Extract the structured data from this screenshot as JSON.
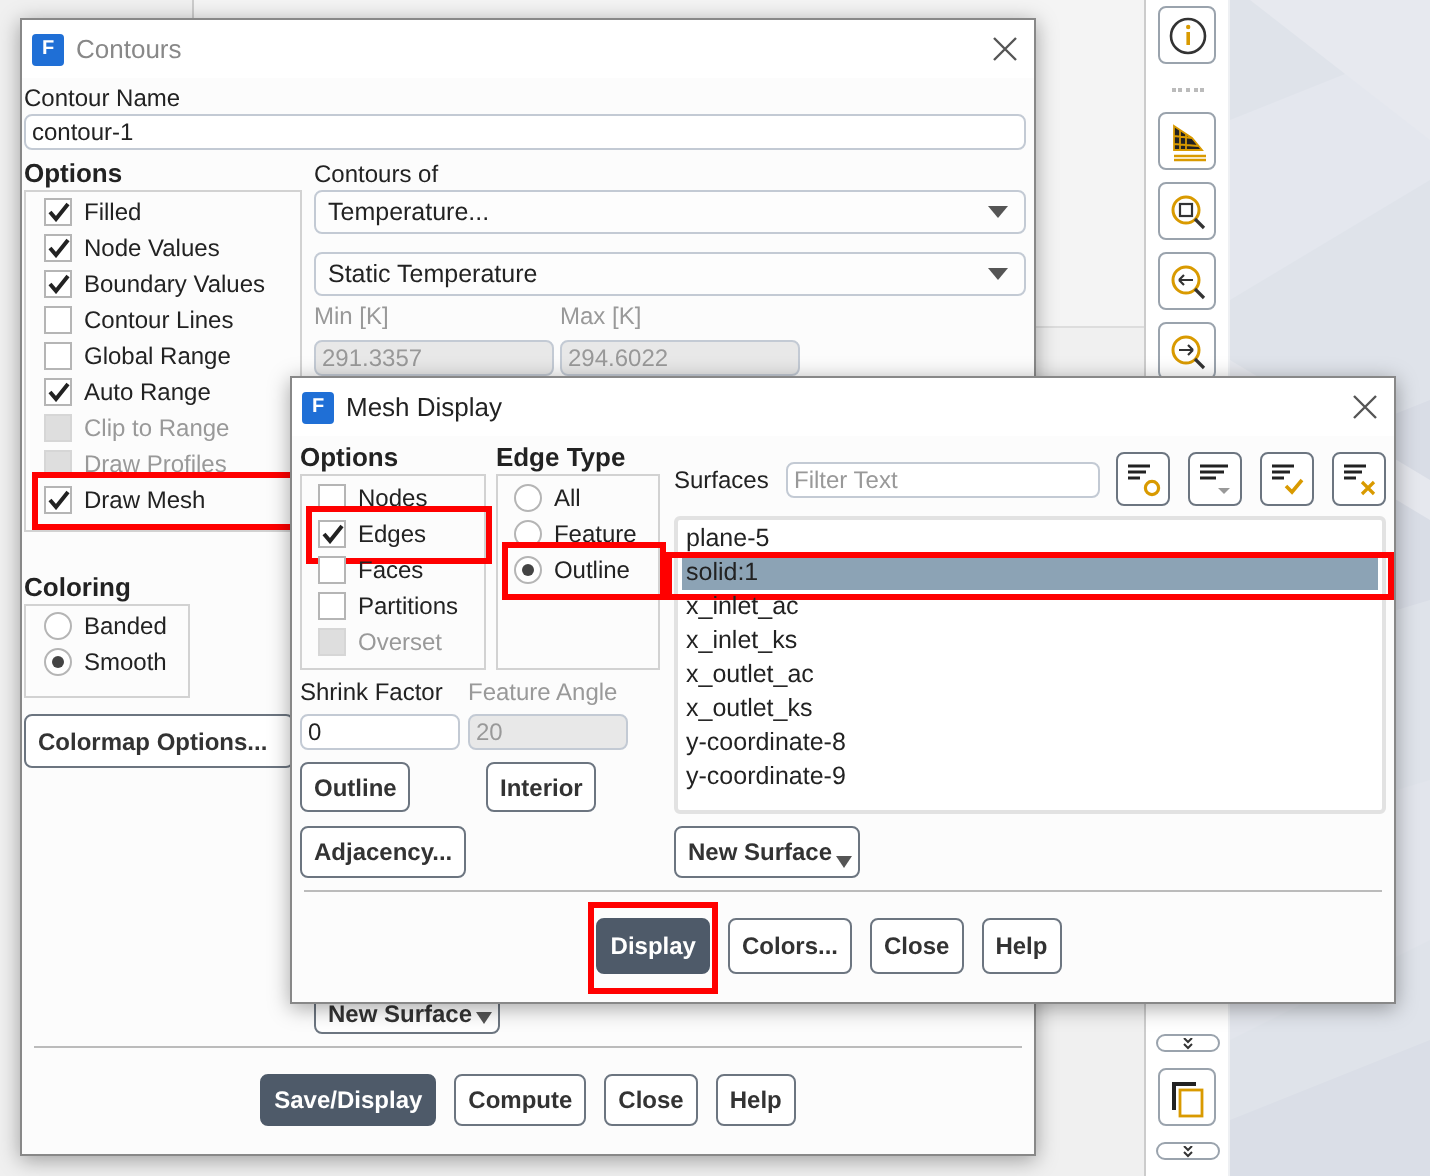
{
  "toolbar": {
    "top_buttons": [
      {
        "kind": "info"
      },
      {
        "kind": "mesh"
      },
      {
        "kind": "zoom_box"
      },
      {
        "kind": "zoom_left"
      },
      {
        "kind": "zoom_right"
      }
    ],
    "bottom_buttons": [
      {
        "kind": "expander"
      },
      {
        "kind": "pages"
      },
      {
        "kind": "expander"
      }
    ]
  },
  "contours_dialog": {
    "app_icon": "F",
    "title": "Contours",
    "contour_name_label": "Contour Name",
    "contour_name": "contour-1",
    "options_label": "Options",
    "options": [
      {
        "label": "Filled",
        "checked": true,
        "disabled": false,
        "highlighted": false
      },
      {
        "label": "Node Values",
        "checked": true,
        "disabled": false,
        "highlighted": false
      },
      {
        "label": "Boundary Values",
        "checked": true,
        "disabled": false,
        "highlighted": false
      },
      {
        "label": "Contour Lines",
        "checked": false,
        "disabled": false,
        "highlighted": false
      },
      {
        "label": "Global Range",
        "checked": false,
        "disabled": false,
        "highlighted": false
      },
      {
        "label": "Auto Range",
        "checked": true,
        "disabled": false,
        "highlighted": false
      },
      {
        "label": "Clip to Range",
        "checked": false,
        "disabled": true,
        "highlighted": false
      },
      {
        "label": "Draw Profiles",
        "checked": false,
        "disabled": true,
        "highlighted": false
      },
      {
        "label": "Draw Mesh",
        "checked": true,
        "disabled": false,
        "highlighted": true
      }
    ],
    "contours_of_label": "Contours of",
    "contours_of": "Temperature...",
    "field_variable": "Static Temperature",
    "min_label": "Min [K]",
    "min_value": "291.3357",
    "max_label": "Max [K]",
    "max_value": "294.6022",
    "coloring_label": "Coloring",
    "coloring": [
      {
        "label": "Banded",
        "selected": false
      },
      {
        "label": "Smooth",
        "selected": true
      }
    ],
    "colormap_button": "Colormap Options...",
    "new_surface_button": "New Surface",
    "buttons": [
      {
        "label": "Save/Display",
        "kind": "primary"
      },
      {
        "label": "Compute",
        "kind": "normal"
      },
      {
        "label": "Close",
        "kind": "normal"
      },
      {
        "label": "Help",
        "kind": "normal"
      }
    ]
  },
  "mesh_dialog": {
    "app_icon": "F",
    "title": "Mesh Display",
    "options_label": "Options",
    "options": [
      {
        "label": "Nodes",
        "checked": false,
        "disabled": false,
        "highlighted": false
      },
      {
        "label": "Edges",
        "checked": true,
        "disabled": false,
        "highlighted": true
      },
      {
        "label": "Faces",
        "checked": false,
        "disabled": false,
        "highlighted": false
      },
      {
        "label": "Partitions",
        "checked": false,
        "disabled": false,
        "highlighted": false
      },
      {
        "label": "Overset",
        "checked": false,
        "disabled": true,
        "highlighted": false
      }
    ],
    "edge_type_label": "Edge Type",
    "edge_types": [
      {
        "label": "All",
        "selected": false,
        "highlighted": false
      },
      {
        "label": "Feature",
        "selected": false,
        "highlighted": false
      },
      {
        "label": "Outline",
        "selected": true,
        "highlighted": true
      }
    ],
    "shrink_factor_label": "Shrink Factor",
    "shrink_factor": "0",
    "feature_angle_label": "Feature Angle",
    "feature_angle": "20",
    "outline_button": "Outline",
    "interior_button": "Interior",
    "adjacency_button": "Adjacency...",
    "surfaces_label": "Surfaces",
    "filter_placeholder": "Filter Text",
    "list_tools": [
      {
        "kind": "circle"
      },
      {
        "kind": "dropdown"
      },
      {
        "kind": "check"
      },
      {
        "kind": "cross"
      }
    ],
    "surfaces": [
      {
        "label": "plane-5",
        "selected": false,
        "highlighted": false
      },
      {
        "label": "solid:1",
        "selected": true,
        "highlighted": true
      },
      {
        "label": "x_inlet_ac",
        "selected": false,
        "highlighted": false
      },
      {
        "label": "x_inlet_ks",
        "selected": false,
        "highlighted": false
      },
      {
        "label": "x_outlet_ac",
        "selected": false,
        "highlighted": false
      },
      {
        "label": "x_outlet_ks",
        "selected": false,
        "highlighted": false
      },
      {
        "label": "y-coordinate-8",
        "selected": false,
        "highlighted": false
      },
      {
        "label": "y-coordinate-9",
        "selected": false,
        "highlighted": false
      }
    ],
    "new_surface_button": "New Surface",
    "buttons": [
      {
        "label": "Display",
        "kind": "primary",
        "highlighted": true
      },
      {
        "label": "Colors...",
        "kind": "normal",
        "highlighted": false
      },
      {
        "label": "Close",
        "kind": "normal",
        "highlighted": false
      },
      {
        "label": "Help",
        "kind": "normal",
        "highlighted": false
      }
    ]
  }
}
